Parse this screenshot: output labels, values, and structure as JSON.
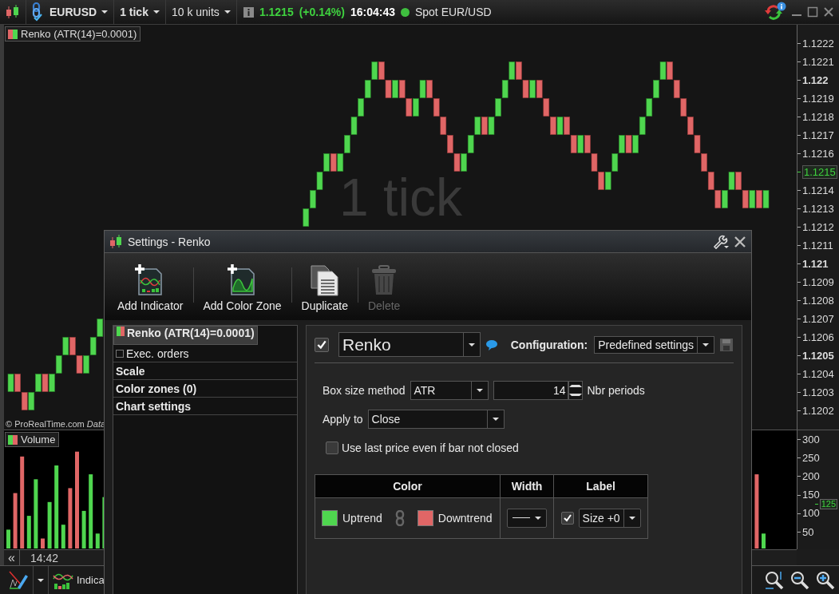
{
  "toolbar": {
    "symbol": "EURUSD",
    "timeframe": "1 tick",
    "quantity": "10 k units",
    "price": "1.1215",
    "change": "(+0.14%)",
    "time": "16:04:43",
    "market_open": true,
    "instrument": "Spot EUR/USD"
  },
  "chart": {
    "indicator_label": "Renko (ATR(14)=0.0001)",
    "background_label": "1 tick",
    "copyright": "© ProRealTime.com *Data*",
    "price_axis": [
      {
        "label": "1.1222",
        "major": false,
        "current": false
      },
      {
        "label": "1.1221",
        "major": false,
        "current": false
      },
      {
        "label": "1.122",
        "major": true,
        "current": false
      },
      {
        "label": "1.1219",
        "major": false,
        "current": false
      },
      {
        "label": "1.1218",
        "major": false,
        "current": false
      },
      {
        "label": "1.1217",
        "major": false,
        "current": false
      },
      {
        "label": "1.1216",
        "major": false,
        "current": false
      },
      {
        "label": "1.1215",
        "major": false,
        "current": true
      },
      {
        "label": "1.1214",
        "major": false,
        "current": false
      },
      {
        "label": "1.1213",
        "major": false,
        "current": false
      },
      {
        "label": "1.1212",
        "major": false,
        "current": false
      },
      {
        "label": "1.1211",
        "major": false,
        "current": false
      },
      {
        "label": "1.121",
        "major": true,
        "current": false
      },
      {
        "label": "1.1209",
        "major": false,
        "current": false
      },
      {
        "label": "1.1208",
        "major": false,
        "current": false
      },
      {
        "label": "1.1207",
        "major": false,
        "current": false
      },
      {
        "label": "1.1206",
        "major": false,
        "current": false
      },
      {
        "label": "1.1205",
        "major": true,
        "current": false
      },
      {
        "label": "1.1204",
        "major": false,
        "current": false
      },
      {
        "label": "1.1203",
        "major": false,
        "current": false
      },
      {
        "label": "1.1202",
        "major": false,
        "current": false
      }
    ],
    "volume_label": "Volume",
    "volume_axis": [
      {
        "label": "300",
        "current": false
      },
      {
        "label": "250",
        "current": false
      },
      {
        "label": "200",
        "current": false
      },
      {
        "label": "150",
        "current": false
      },
      {
        "label": "125",
        "current": true
      },
      {
        "label": "100",
        "current": false
      },
      {
        "label": "50",
        "current": false
      }
    ],
    "time_axis": {
      "scroll_button": "«",
      "time": "14:42"
    }
  },
  "bottom_toolbar": {
    "indicators_button": "Indica"
  },
  "dialog": {
    "title": "Settings - Renko",
    "actions": [
      {
        "label": "Add Indicator",
        "kind": "add_indicator",
        "disabled": false
      },
      {
        "label": "Add Color Zone",
        "kind": "add_color_zone",
        "disabled": false
      },
      {
        "label": "Duplicate",
        "kind": "duplicate",
        "disabled": false
      },
      {
        "label": "Delete",
        "kind": "delete",
        "disabled": true
      }
    ],
    "sidebar": [
      {
        "label": "Renko (ATR(14)=0.0001)",
        "kind": "indicator",
        "selected": true
      },
      {
        "label": "Exec. orders",
        "kind": "checkbox",
        "checked": false,
        "selected": false
      },
      {
        "label": "Scale",
        "kind": "section",
        "selected": false
      },
      {
        "label": "Color zones (0)",
        "kind": "section",
        "selected": false
      },
      {
        "label": "Chart settings",
        "kind": "section",
        "selected": false
      }
    ],
    "indicator": {
      "enabled": true,
      "name": "Renko",
      "configuration_label": "Configuration:",
      "configuration": "Predefined settings",
      "save_disabled": true
    },
    "parameters": {
      "box_size_label": "Box size method",
      "box_size_method": "ATR",
      "periods": "14",
      "periods_label": "Nbr periods",
      "apply_to_label": "Apply to",
      "apply_to": "Close",
      "use_last_price": {
        "label": "Use last price even if bar not closed",
        "checked": false
      }
    },
    "style_table": {
      "columns": [
        "Color",
        "Width",
        "Label"
      ],
      "colors": [
        {
          "label": "Uptrend",
          "color": "#4fd64f"
        },
        {
          "label": "Downtrend",
          "color": "#e06666"
        }
      ],
      "label_shown": true,
      "label_size": "Size +0"
    }
  }
}
